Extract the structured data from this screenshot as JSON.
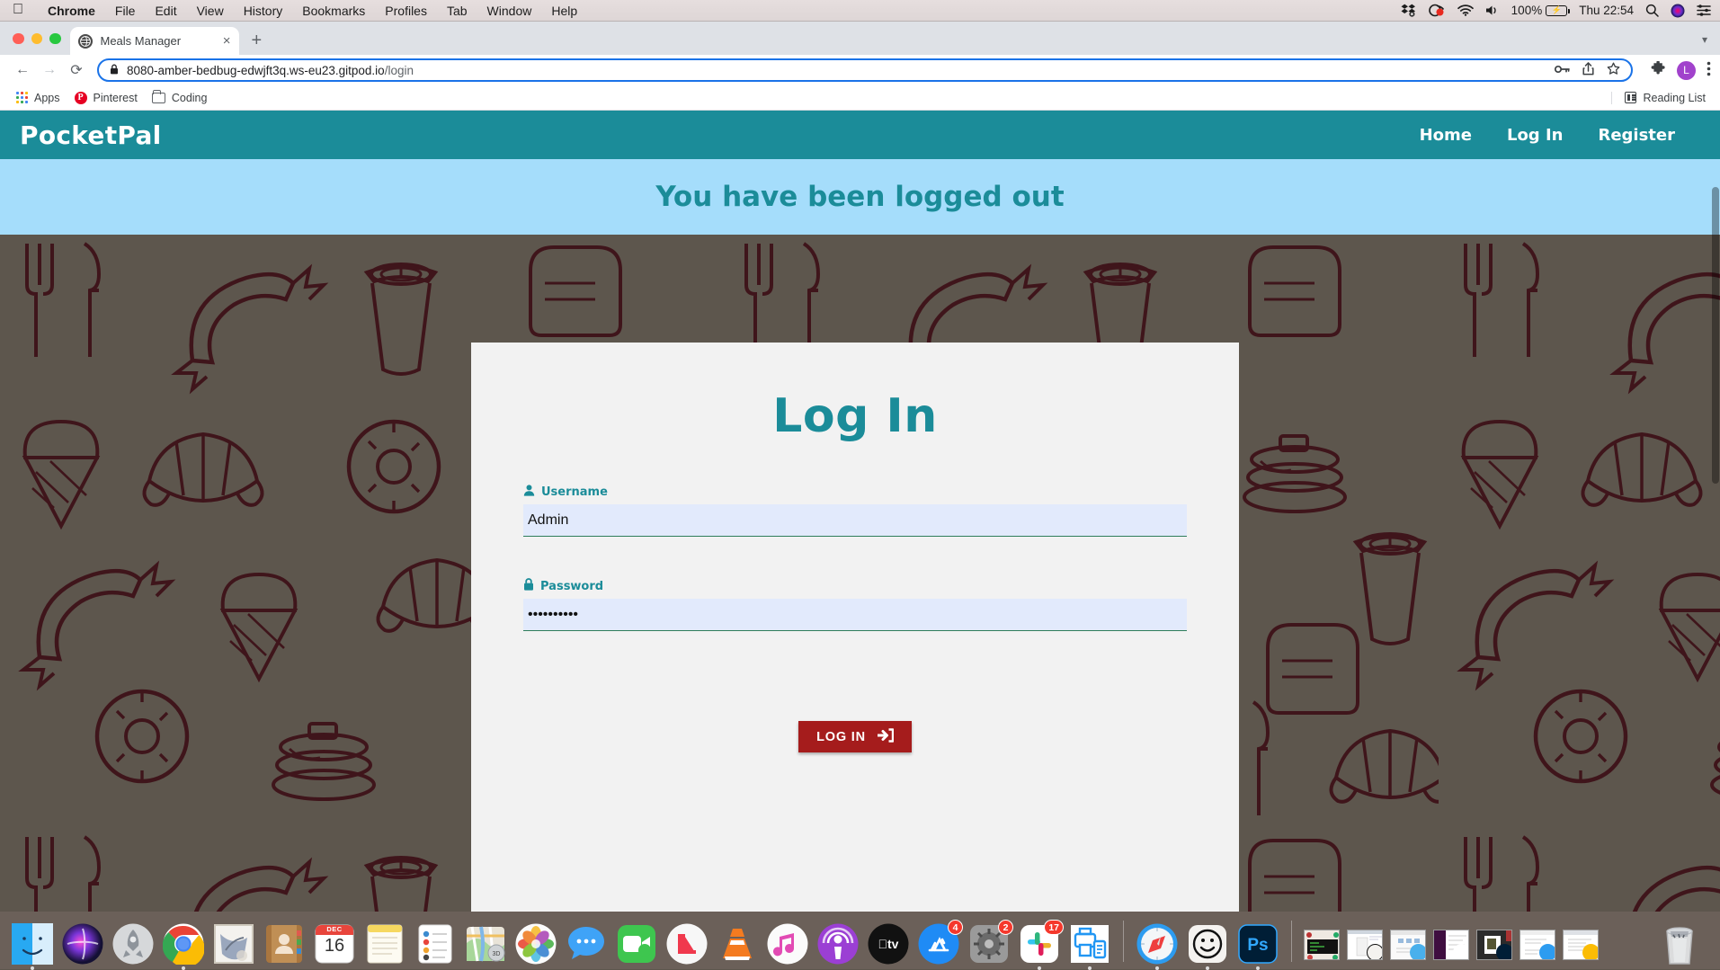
{
  "macbar": {
    "apple_icon": "apple-logo",
    "menus": [
      "Chrome",
      "File",
      "Edit",
      "View",
      "History",
      "Bookmarks",
      "Profiles",
      "Tab",
      "Window",
      "Help"
    ],
    "status": {
      "dropbox_icon": "dropbox-icon",
      "recording_icon": "screen-recording-icon",
      "wifi_icon": "wifi-icon",
      "volume_icon": "volume-icon",
      "battery_percent": "100%",
      "battery_icon": "battery-charging-icon",
      "clock": "Thu 22:54",
      "search_icon": "spotlight-search-icon",
      "siri_icon": "siri-icon",
      "control_center_icon": "control-center-icon"
    }
  },
  "browser": {
    "tab": {
      "title": "Meals Manager",
      "favicon": "globe-favicon",
      "close": "×"
    },
    "new_tab": "+",
    "nav": {
      "back": "←",
      "forward": "→",
      "reload": "⟳"
    },
    "omnibox": {
      "lock_icon": "lock-icon",
      "url_host": "8080-amber-bedbug-edwjft3q.ws-eu23.gitpod.io",
      "url_path": "/login",
      "key_icon": "password-key-icon",
      "share_icon": "share-icon",
      "star_icon": "bookmark-star-icon"
    },
    "toolbar": {
      "extensions_icon": "extensions-puzzle-icon",
      "profile_initial": "L",
      "menu_icon": "three-dot-menu-icon"
    },
    "bookmarks": [
      {
        "label": "Apps",
        "icon": "apps-grid-icon"
      },
      {
        "label": "Pinterest",
        "icon": "pinterest-icon"
      },
      {
        "label": "Coding",
        "icon": "folder-icon"
      }
    ],
    "reading_list": {
      "label": "Reading List",
      "icon": "reading-list-icon"
    }
  },
  "site": {
    "brand": "PocketPal",
    "nav_links": [
      "Home",
      "Log In",
      "Register"
    ],
    "alert": "You have been logged out",
    "login_card": {
      "heading": "Log In",
      "username": {
        "label": "Username",
        "icon": "user-icon",
        "value": "Admin",
        "placeholder": ""
      },
      "password": {
        "label": "Password",
        "icon": "lock-icon",
        "value": "••••••••••",
        "placeholder": ""
      },
      "submit": {
        "label": "LOG IN",
        "icon": "sign-in-arrow-icon"
      }
    },
    "colors": {
      "brand_teal": "#1b8c99",
      "alert_blue": "#a5ddfb",
      "card_gray": "#f2f2f2",
      "button_red": "#a51c1c",
      "input_blue": "#e2eafc",
      "background": "#5d564d",
      "pattern_line": "#3d1218"
    }
  },
  "dock": {
    "apps": [
      {
        "name": "finder",
        "running": true
      },
      {
        "name": "siri",
        "running": false
      },
      {
        "name": "launchpad",
        "running": false
      },
      {
        "name": "google-chrome",
        "running": true
      },
      {
        "name": "mail",
        "running": false
      },
      {
        "name": "contacts",
        "running": false
      },
      {
        "name": "calendar",
        "running": false,
        "month": "DEC",
        "day": "16"
      },
      {
        "name": "notes",
        "running": false
      },
      {
        "name": "reminders",
        "running": false
      },
      {
        "name": "maps",
        "running": false
      },
      {
        "name": "photos",
        "running": false
      },
      {
        "name": "messages",
        "running": false
      },
      {
        "name": "facetime",
        "running": false
      },
      {
        "name": "news",
        "running": false
      },
      {
        "name": "vlc",
        "running": false
      },
      {
        "name": "music",
        "running": false
      },
      {
        "name": "podcasts",
        "running": false
      },
      {
        "name": "apple-tv",
        "running": false
      },
      {
        "name": "app-store",
        "badge": "4",
        "running": false
      },
      {
        "name": "system-preferences",
        "badge": "2",
        "running": false
      },
      {
        "name": "slack",
        "badge": "17",
        "running": true
      },
      {
        "name": "printer-utility",
        "running": true
      },
      {
        "name": "safari",
        "running": true
      },
      {
        "name": "bitmoji",
        "running": true
      },
      {
        "name": "photoshop",
        "running": true
      }
    ],
    "minimized": [
      {
        "name": "terminal-window"
      },
      {
        "name": "bitmoji-window"
      },
      {
        "name": "finder-window"
      },
      {
        "name": "slack-window"
      },
      {
        "name": "photoshop-window"
      },
      {
        "name": "safari-window"
      },
      {
        "name": "chrome-window"
      }
    ],
    "trash": {
      "name": "trash"
    }
  }
}
